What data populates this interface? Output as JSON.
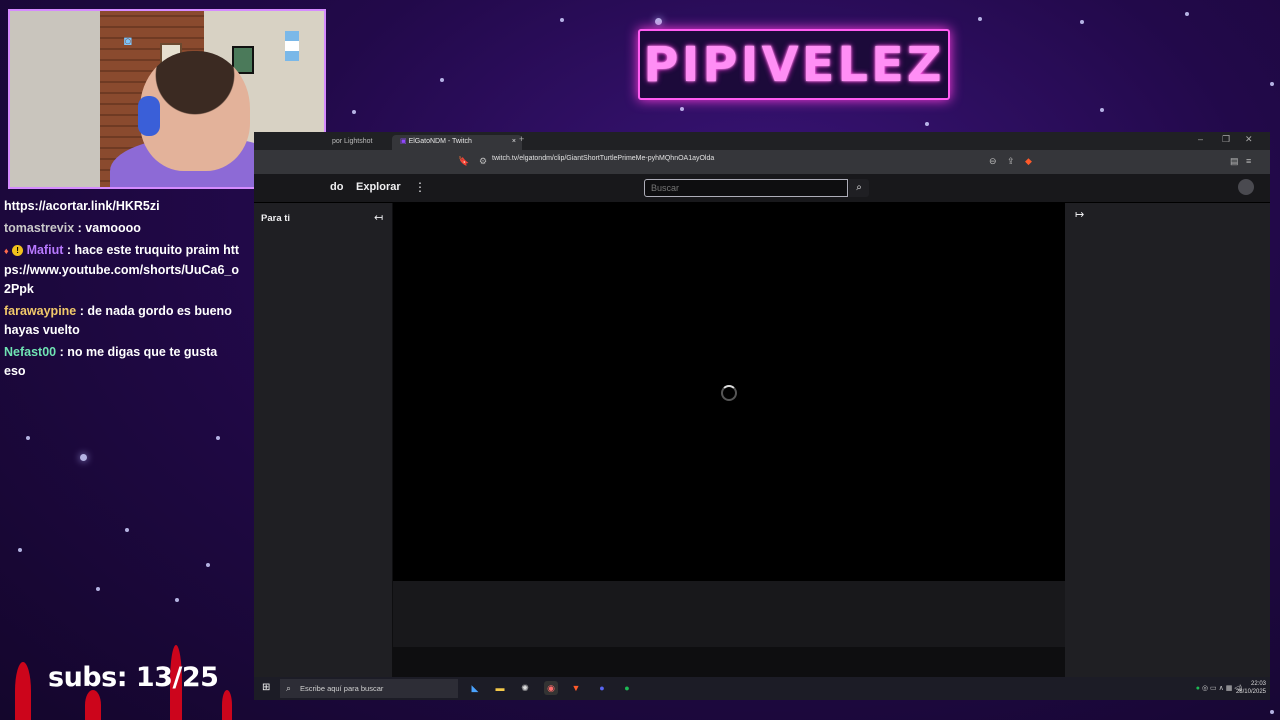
{
  "logo": {
    "text": "PIPIVELEZ"
  },
  "subs": {
    "text": "subs: 13/25"
  },
  "chat": {
    "link_line": "https://acortar.link/HKR5zi",
    "messages": [
      {
        "user": "tomastrevix",
        "sep": " : ",
        "text": "vamoooo"
      },
      {
        "user": "Mafiut",
        "sep": " : ",
        "text": "hace este truquito praim https://www.youtube.com/shorts/UuCa6_o2Ppk"
      },
      {
        "user": "farawaypine",
        "sep": " : ",
        "text": "de nada gordo es bueno hayas vuelto"
      },
      {
        "user": "Nefast00",
        "sep": " : ",
        "text": "no me digas que te gusta eso"
      }
    ]
  },
  "browser": {
    "tabs": [
      {
        "label": "por Lightshot"
      },
      {
        "label": "ElGatoNDM - Twitch"
      }
    ],
    "tab_close": "×",
    "new_tab": "+",
    "url": "twitch.tv/elgatondm/clip/GiantShortTurtlePrimeMe-pyhMQhnOA1ayOlda"
  },
  "twitch": {
    "nav_fragment": "do",
    "explore": "Explorar",
    "more": "⋮",
    "search_placeholder": "Buscar",
    "for_you": "Para ti",
    "collapse_left": "↤",
    "collapse_right": "↦"
  },
  "taskbar": {
    "search_placeholder": "Escribe aquí para buscar",
    "clock_time": "22:03",
    "clock_date": "28/10/2025"
  },
  "colors": {
    "logo_neon": "#ff8ef5",
    "twitch_purple": "#9146ff",
    "background": "#22094a"
  }
}
